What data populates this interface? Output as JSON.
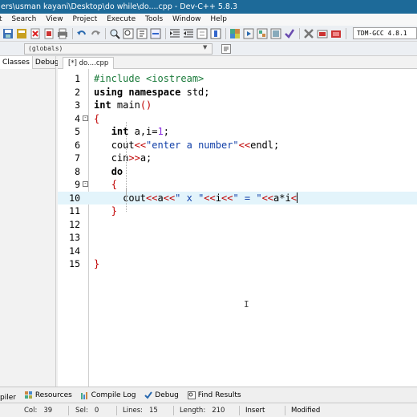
{
  "window": {
    "title": "ers\\usman kayani\\Desktop\\do while\\do....cpp - Dev-C++ 5.8.3"
  },
  "menu": [
    "t",
    "Search",
    "View",
    "Project",
    "Execute",
    "Tools",
    "Window",
    "Help"
  ],
  "toolbar": {
    "compiler": "TDM-GCC 4.8.1"
  },
  "toolbar2": {
    "scope": "(globals)"
  },
  "left_panel": {
    "tabs": [
      "Classes",
      "Debug"
    ]
  },
  "editor": {
    "file_tab": "[*] do....cpp",
    "lines": [
      {
        "n": "1",
        "fold": ""
      },
      {
        "n": "2",
        "fold": ""
      },
      {
        "n": "3",
        "fold": ""
      },
      {
        "n": "4",
        "fold": "-"
      },
      {
        "n": "5",
        "fold": ""
      },
      {
        "n": "6",
        "fold": ""
      },
      {
        "n": "7",
        "fold": ""
      },
      {
        "n": "8",
        "fold": ""
      },
      {
        "n": "9",
        "fold": "-"
      },
      {
        "n": "10",
        "fold": ""
      },
      {
        "n": "11",
        "fold": ""
      },
      {
        "n": "12",
        "fold": ""
      },
      {
        "n": "13",
        "fold": ""
      },
      {
        "n": "14",
        "fold": ""
      },
      {
        "n": "15",
        "fold": ""
      }
    ],
    "code": {
      "l1": "#include <iostream>",
      "l2a": "using namespace",
      "l2b": " std;",
      "l3a": "int",
      "l3b": " main",
      "l4": "{",
      "l5a": "int",
      "l5b": " a,i=",
      "l5c": "1",
      "l6a": "cout",
      "l6b": "<<",
      "l6c": "\"enter a number\"",
      "l6d": "<<",
      "l6e": "endl;",
      "l7a": "cin",
      "l7b": ">>",
      "l7c": "a;",
      "l8": "do",
      "l9": "{",
      "l10a": "cout",
      "l10b": "<<",
      "l10c": "a",
      "l10d": "<<",
      "l10e": "\" x \"",
      "l10f": "<<",
      "l10g": "i",
      "l10h": "<<",
      "l10i": "\" = \"",
      "l10j": "<<",
      "l10k": "a*i",
      "l10l": "<",
      "l11": "}",
      "l15": "}"
    }
  },
  "bottom_tabs": [
    "piler",
    "Resources",
    "Compile Log",
    "Debug",
    "Find Results"
  ],
  "status": {
    "col_label": "Col:",
    "col": "39",
    "sel_label": "Sel:",
    "sel": "0",
    "lines_label": "Lines:",
    "lines": "15",
    "length_label": "Length:",
    "length": "210",
    "mode": "Insert",
    "state": "Modified"
  },
  "colors": {
    "titlebar": "#1d6a99",
    "active_line": "#e3f4fb",
    "keyword": "#000000",
    "string": "#1240a8",
    "operator": "#c00000",
    "preprocessor": "#1a7a3a"
  }
}
